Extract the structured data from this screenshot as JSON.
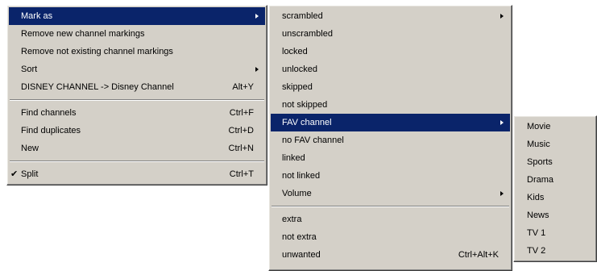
{
  "main_menu": {
    "items": [
      {
        "label": "Mark as",
        "shortcut": "",
        "submenu": true,
        "selected": true
      },
      {
        "label": "Remove new channel markings",
        "shortcut": ""
      },
      {
        "label": "Remove not existing channel markings",
        "shortcut": ""
      },
      {
        "label": "Sort",
        "shortcut": "",
        "submenu": true
      },
      {
        "label": "DISNEY CHANNEL -> Disney Channel",
        "shortcut": "Alt+Y"
      },
      {
        "label": "Find channels",
        "shortcut": "Ctrl+F"
      },
      {
        "label": "Find duplicates",
        "shortcut": "Ctrl+D"
      },
      {
        "label": "New",
        "shortcut": "Ctrl+N"
      },
      {
        "label": "Split",
        "shortcut": "Ctrl+T",
        "checked": true
      }
    ]
  },
  "mark_as_menu": {
    "items": [
      {
        "label": "scrambled",
        "submenu": true
      },
      {
        "label": "unscrambled"
      },
      {
        "label": "locked"
      },
      {
        "label": "unlocked"
      },
      {
        "label": "skipped"
      },
      {
        "label": "not skipped"
      },
      {
        "label": "FAV channel",
        "submenu": true,
        "selected": true
      },
      {
        "label": "no FAV channel"
      },
      {
        "label": "linked"
      },
      {
        "label": "not linked"
      },
      {
        "label": "Volume",
        "submenu": true
      },
      {
        "label": "extra"
      },
      {
        "label": "not extra"
      },
      {
        "label": "unwanted",
        "shortcut": "Ctrl+Alt+K"
      }
    ]
  },
  "fav_menu": {
    "items": [
      "Movie",
      "Music",
      "Sports",
      "Drama",
      "Kids",
      "News",
      "TV 1",
      "TV 2"
    ]
  },
  "colors": {
    "menu_bg": "#d4d0c8",
    "highlight": "#0a246a",
    "highlight_text": "#ffffff"
  },
  "icons": {
    "submenu": "submenu-arrow-icon",
    "check": "checkmark-icon"
  }
}
